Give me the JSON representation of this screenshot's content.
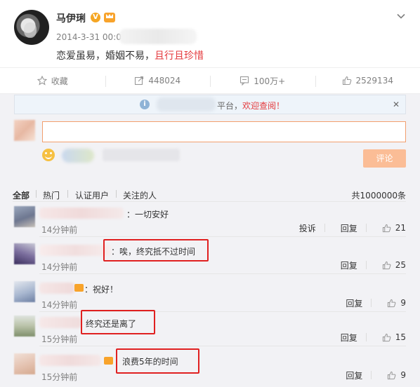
{
  "post": {
    "author": "马伊琍",
    "verified_badge": "V",
    "time": "2014-3-31 00:07",
    "text_prefix": "恋爱虽易，婚姻不易，",
    "text_highlight": "且行且珍惜",
    "more_icon": "chevron-down-icon"
  },
  "actions": {
    "favorite": "收藏",
    "repost_count": "448024",
    "comment_count": "100万+",
    "like_count": "2529134"
  },
  "notice": {
    "info": "i",
    "text_tail": "平台，",
    "text_highlight": "欢迎查阅！",
    "close": "✕"
  },
  "composer": {
    "input_value": "",
    "submit_label": "评论"
  },
  "filters": {
    "tabs": [
      "全部",
      "热门",
      "认证用户",
      "关注的人"
    ],
    "total": "共1000000条"
  },
  "comments": [
    {
      "text": "：一切安好",
      "time": "14分钟前",
      "report": "投诉",
      "reply": "回复",
      "likes": "21"
    },
    {
      "text": "：唉，终究抵不过时间",
      "time": "14分钟前",
      "reply": "回复",
      "likes": "25"
    },
    {
      "text": "：祝好！",
      "time": "14分钟前",
      "reply": "回复",
      "likes": "9"
    },
    {
      "text": "终究还是离了",
      "time": "15分钟前",
      "reply": "回复",
      "likes": "15"
    },
    {
      "text": "浪费5年的时间",
      "time": "15分钟前",
      "reply": "回复",
      "likes": "9"
    }
  ],
  "colors": {
    "accent": "#e4393c",
    "submit_bg": "#fbbd96",
    "input_border": "#f29f6e",
    "highlight_box": "#e02020"
  }
}
